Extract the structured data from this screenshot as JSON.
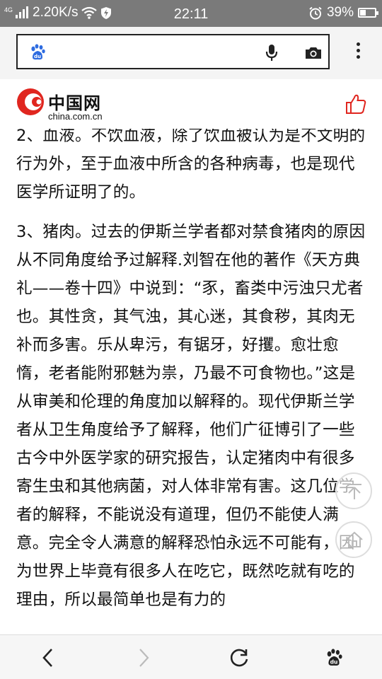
{
  "status_bar": {
    "network_type": "4G",
    "speed": "2.20K/s",
    "time": "22:11",
    "battery_percent": "39%",
    "battery_level": 0.39
  },
  "browser": {
    "search_placeholder": "",
    "icons": [
      "baidu-paw-icon",
      "microphone-icon",
      "camera-icon",
      "more-menu-icon"
    ]
  },
  "site": {
    "logo_name": "中国网",
    "logo_domain": "china.com.cn",
    "like_icon": "thumbs-up-icon"
  },
  "article": {
    "paragraphs": [
      "2、血液。不饮血液，除了饮血被认为是不文明的行为外，至于血液中所含的各种病毒，也是现代医学所证明了的。",
      "3、猪肉。过去的伊斯兰学者都对禁食猪肉的原因从不同角度给予过解释.刘智在他的著作《天方典礼——卷十四》中说到：“豕，畜类中污浊只尤者也。其性贪，其气浊，其心迷，其食秽，其肉无补而多害。乐从卑污，有锯牙，好攫。愈壮愈惰，老者能附邪魅为祟，乃最不可食物也。”这是从审美和伦理的角度加以解释的。现代伊斯兰学者从卫生角度给予了解释，他们广征博引了一些古今中外医学家的研究报告，认定猪肉中有很多寄生虫和其他病菌，对人体非常有害。这几位学者的解释，不能说没有道理，但仍不能使人满意。完全令人满意的解释恐怕永远不可能有，因为世界上毕竟有很多人在吃它，既然吃就有吃的理由，所以最简单也是有力的"
    ]
  },
  "floating": {
    "top_icon": "back-to-top-icon",
    "home_icon": "home-icon"
  },
  "bottom_nav": {
    "icons": [
      "back-arrow-icon",
      "forward-arrow-icon",
      "refresh-icon",
      "baidu-paw-icon"
    ]
  }
}
